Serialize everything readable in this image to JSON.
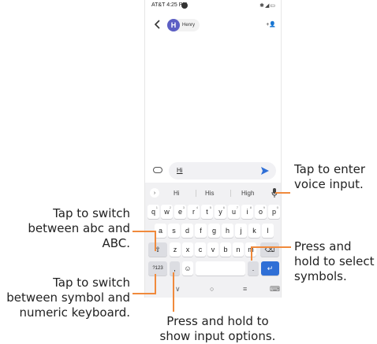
{
  "status_bar": {
    "carrier_time": "AT&T 4:25 PM",
    "icons": "✱◢▭"
  },
  "header": {
    "avatar_letter": "H",
    "contact_name": "Henry",
    "add_person_glyph": "+👤"
  },
  "compose": {
    "input_text": "Hi"
  },
  "keyboard": {
    "suggestions": [
      "Hi",
      "His",
      "High"
    ],
    "chevron": "›",
    "row1": [
      {
        "k": "q",
        "n": "1"
      },
      {
        "k": "w",
        "n": "2"
      },
      {
        "k": "e",
        "n": "3"
      },
      {
        "k": "r",
        "n": "4"
      },
      {
        "k": "t",
        "n": "5"
      },
      {
        "k": "y",
        "n": "6"
      },
      {
        "k": "u",
        "n": "7"
      },
      {
        "k": "i",
        "n": "8"
      },
      {
        "k": "o",
        "n": "9"
      },
      {
        "k": "p",
        "n": "0"
      }
    ],
    "row2": [
      "a",
      "s",
      "d",
      "f",
      "g",
      "h",
      "j",
      "k",
      "l"
    ],
    "row3": [
      "z",
      "x",
      "c",
      "v",
      "b",
      "n",
      "m"
    ],
    "shift_glyph": "⇧",
    "backspace_glyph": "⌫",
    "symbols_key": "?123",
    "comma_key": ",",
    "emoji_glyph": "☺",
    "period_key": ".",
    "enter_glyph": "↵",
    "nav": [
      "∨",
      "○",
      "≡",
      "⌨"
    ]
  },
  "callouts": {
    "switch_abc": [
      "Tap to switch",
      "between abc and",
      "ABC."
    ],
    "switch_symbol": [
      "Tap to switch",
      "between symbol and",
      "numeric keyboard."
    ],
    "voice_input": [
      "Tap to enter",
      "voice input."
    ],
    "select_symbols": [
      "Press and",
      "hold to select",
      "symbols."
    ],
    "input_options": [
      "Press and hold to",
      "show input options."
    ]
  }
}
